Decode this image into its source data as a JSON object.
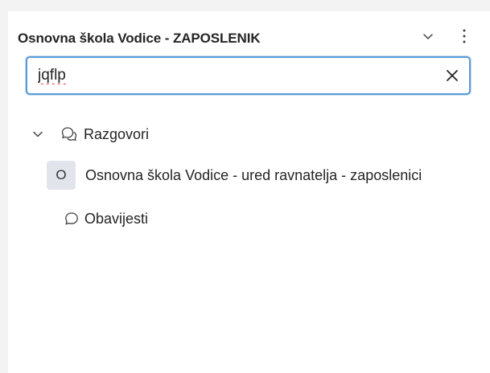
{
  "header": {
    "title": "Osnovna škola Vodice - ZAPOSLENIK",
    "collapse_icon": "chevron-down-icon",
    "more_icon": "more-vertical-icon"
  },
  "search": {
    "value": "jqflp",
    "clear_icon": "close-icon"
  },
  "tree": {
    "group": {
      "label": "Razgovori",
      "expanded": true,
      "icon": "chat-multiple-icon"
    },
    "items": [
      {
        "avatar_text": "O",
        "label": "Osnovna škola Vodice - ured ravnatelja - zaposlenici"
      },
      {
        "icon": "chat-icon",
        "label": "Obavijesti"
      }
    ]
  },
  "colors": {
    "focus_border": "#5b9bd5",
    "avatar_bg": "#e1e4ea",
    "background": "#f3f3f3",
    "panel": "#ffffff"
  }
}
